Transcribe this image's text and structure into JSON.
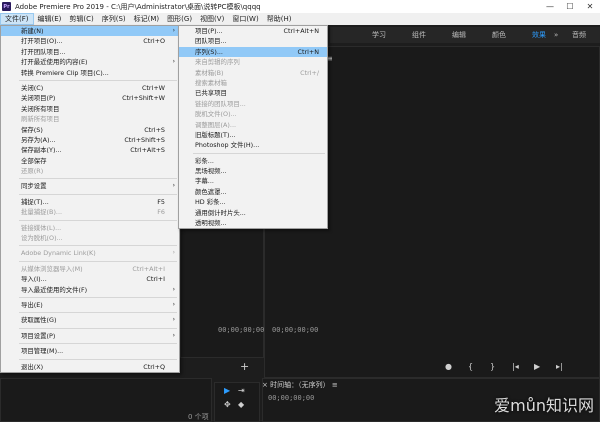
{
  "window": {
    "title": "Adobe Premiere Pro 2019 - C:\\用户\\Administrator\\桌面\\说转PC模板\\qqqq",
    "logo_text": "Pr",
    "min": "—",
    "max": "☐",
    "close": "✕"
  },
  "menubar": [
    "文件(F)",
    "编辑(E)",
    "剪辑(C)",
    "序列(S)",
    "标记(M)",
    "图形(G)",
    "视图(V)",
    "窗口(W)",
    "帮助(H)"
  ],
  "workspace_tabs": [
    "学习",
    "组件",
    "编辑",
    "颜色",
    "效果",
    "音频"
  ],
  "workspace_more": "»",
  "program_menu_icon": "≡",
  "timecodes": {
    "left": "00;00;00;00",
    "mid": "00;00;00;00"
  },
  "timeline": {
    "title": "时间轴：（无序列）",
    "close": "×",
    "menu": "≡"
  },
  "left_panel": {
    "count": "0 个项"
  },
  "file_menu": [
    {
      "label": "新建(N)",
      "arrow": "›",
      "hl": true
    },
    {
      "label": "打开项目(O)...",
      "sc": "Ctrl+O"
    },
    {
      "label": "打开团队项目..."
    },
    {
      "label": "打开最近使用的内容(E)",
      "arrow": "›"
    },
    {
      "label": "转换 Premiere Clip 项目(C)..."
    },
    {
      "sep": true
    },
    {
      "label": "关闭(C)",
      "sc": "Ctrl+W"
    },
    {
      "label": "关闭项目(P)",
      "sc": "Ctrl+Shift+W"
    },
    {
      "label": "关闭所有项目"
    },
    {
      "label": "刷新所有项目",
      "dis": true
    },
    {
      "label": "保存(S)",
      "sc": "Ctrl+S"
    },
    {
      "label": "另存为(A)...",
      "sc": "Ctrl+Shift+S"
    },
    {
      "label": "保存副本(Y)...",
      "sc": "Ctrl+Alt+S"
    },
    {
      "label": "全部保存"
    },
    {
      "label": "还原(R)",
      "dis": true
    },
    {
      "sep": true
    },
    {
      "label": "同步设置",
      "arrow": "›"
    },
    {
      "sep": true
    },
    {
      "label": "捕捉(T)...",
      "sc": "F5"
    },
    {
      "label": "批量捕捉(B)...",
      "sc": "F6",
      "dis": true
    },
    {
      "sep": true
    },
    {
      "label": "链接媒体(L)...",
      "dis": true
    },
    {
      "label": "设为脱机(O)...",
      "dis": true
    },
    {
      "sep": true
    },
    {
      "label": "Adobe Dynamic Link(K)",
      "arrow": "›",
      "dis": true
    },
    {
      "sep": true
    },
    {
      "label": "从媒体浏览器导入(M)",
      "sc": "Ctrl+Alt+I",
      "dis": true
    },
    {
      "label": "导入(I)...",
      "sc": "Ctrl+I"
    },
    {
      "label": "导入最近使用的文件(F)",
      "arrow": "›"
    },
    {
      "sep": true
    },
    {
      "label": "导出(E)",
      "arrow": "›"
    },
    {
      "sep": true
    },
    {
      "label": "获取属性(G)",
      "arrow": "›"
    },
    {
      "sep": true
    },
    {
      "label": "项目设置(P)",
      "arrow": "›"
    },
    {
      "sep": true
    },
    {
      "label": "项目管理(M)..."
    },
    {
      "sep": true
    },
    {
      "label": "退出(X)",
      "sc": "Ctrl+Q"
    }
  ],
  "new_submenu": [
    {
      "label": "项目(P)...",
      "sc": "Ctrl+Alt+N"
    },
    {
      "label": "团队项目..."
    },
    {
      "label": "序列(S)...",
      "sc": "Ctrl+N",
      "hl": true
    },
    {
      "label": "来自剪辑的序列",
      "dis": true
    },
    {
      "label": "素材箱(B)",
      "sc": "Ctrl+/",
      "dis": true
    },
    {
      "label": "搜索素材箱",
      "dis": true
    },
    {
      "label": "已共享项目"
    },
    {
      "label": "链接的团队项目...",
      "dis": true
    },
    {
      "label": "脱机文件(O)...",
      "dis": true
    },
    {
      "label": "调整图层(A)...",
      "dis": true
    },
    {
      "label": "旧版标题(T)..."
    },
    {
      "label": "Photoshop 文件(H)..."
    },
    {
      "sep": true
    },
    {
      "label": "彩条..."
    },
    {
      "label": "黑场视频..."
    },
    {
      "label": "字幕..."
    },
    {
      "label": "颜色遮罩..."
    },
    {
      "label": "HD 彩条..."
    },
    {
      "label": "通用倒计时片头..."
    },
    {
      "label": "透明视频..."
    }
  ],
  "watermark": "爱můn知识网",
  "colors": {
    "accent": "#2d9dff",
    "menu_hl": "#91c9f7"
  }
}
